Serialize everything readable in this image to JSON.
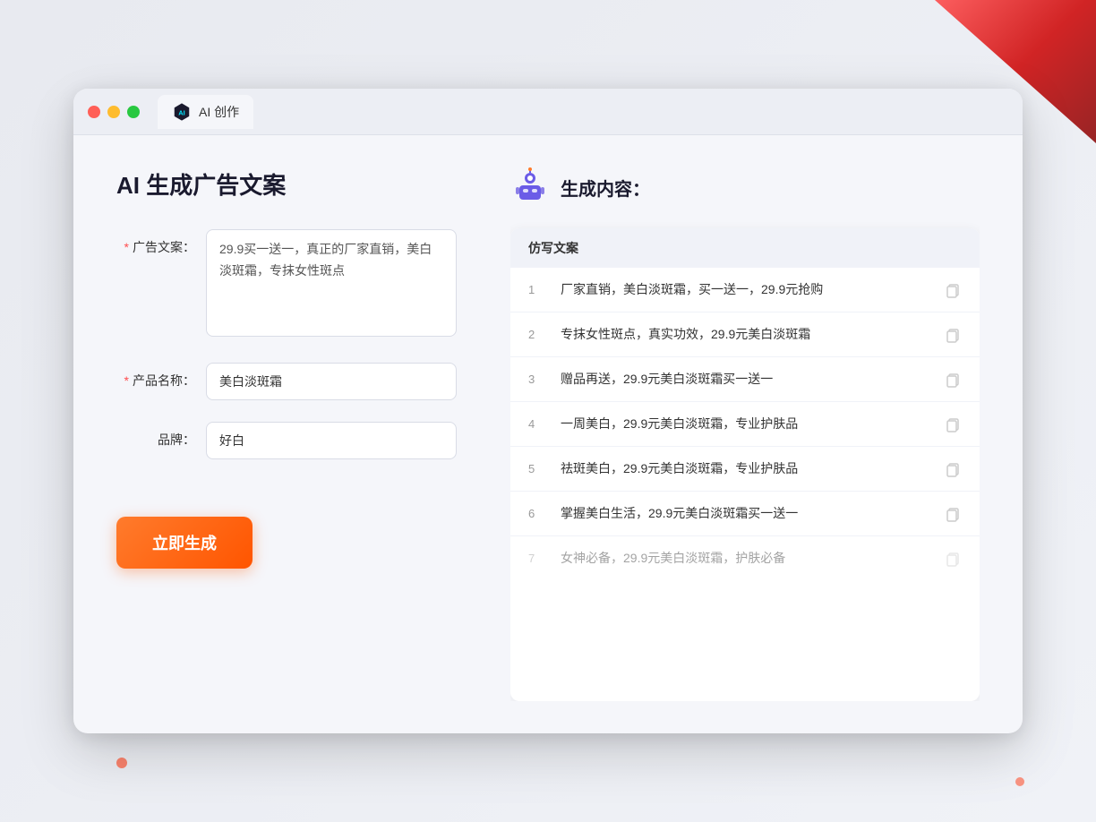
{
  "decorative": {
    "corner_tr": "top-right red triangle",
    "corner_bl": "bottom-left dots"
  },
  "browser": {
    "tab_label": "AI 创作"
  },
  "left_panel": {
    "title": "AI 生成广告文案",
    "form": {
      "ad_copy_label": "广告文案：",
      "ad_copy_required": "*",
      "ad_copy_value": "29.9买一送一，真正的厂家直销，美白淡斑霜，专抹女性斑点",
      "product_name_label": "产品名称：",
      "product_name_required": "*",
      "product_name_value": "美白淡斑霜",
      "brand_label": "品牌：",
      "brand_value": "好白",
      "generate_button": "立即生成"
    }
  },
  "right_panel": {
    "title": "生成内容：",
    "column_header": "仿写文案",
    "results": [
      {
        "num": "1",
        "text": "厂家直销，美白淡斑霜，买一送一，29.9元抢购"
      },
      {
        "num": "2",
        "text": "专抹女性斑点，真实功效，29.9元美白淡斑霜"
      },
      {
        "num": "3",
        "text": "赠品再送，29.9元美白淡斑霜买一送一"
      },
      {
        "num": "4",
        "text": "一周美白，29.9元美白淡斑霜，专业护肤品"
      },
      {
        "num": "5",
        "text": "祛斑美白，29.9元美白淡斑霜，专业护肤品"
      },
      {
        "num": "6",
        "text": "掌握美白生活，29.9元美白淡斑霜买一送一"
      },
      {
        "num": "7",
        "text": "女神必备，29.9元美白淡斑霜，护肤必备",
        "faded": true
      }
    ]
  }
}
